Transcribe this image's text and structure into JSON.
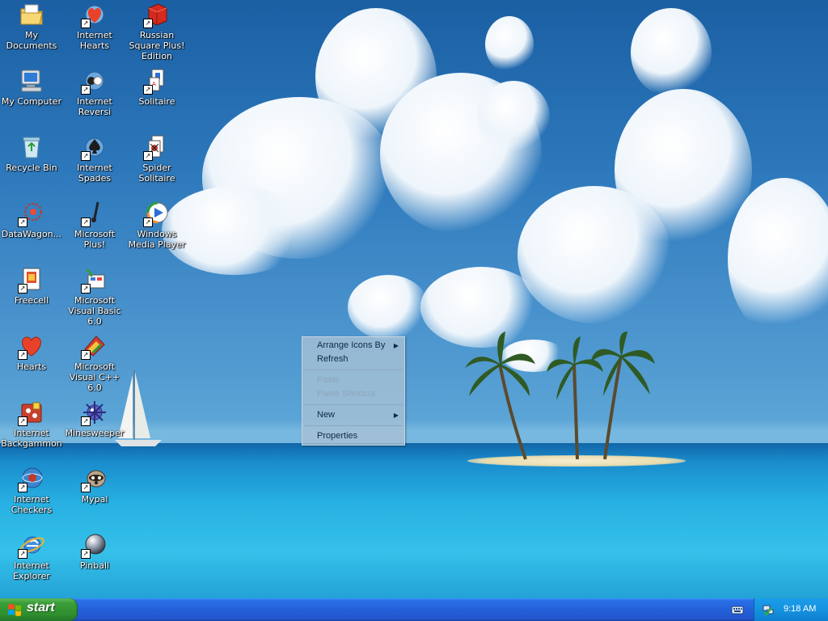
{
  "desktop": {
    "icons": [
      {
        "label": "My Documents"
      },
      {
        "label": "Internet Hearts"
      },
      {
        "label": "Russian Square Plus! Edition"
      },
      {
        "label": "My Computer"
      },
      {
        "label": "Internet Reversi"
      },
      {
        "label": "Solitaire"
      },
      {
        "label": "Recycle Bin"
      },
      {
        "label": "Internet Spades"
      },
      {
        "label": "Spider Solitaire"
      },
      {
        "label": "DataWagon..."
      },
      {
        "label": "Microsoft Plus!"
      },
      {
        "label": "Windows Media Player"
      },
      {
        "label": "Freecell"
      },
      {
        "label": "Microsoft Visual Basic 6.0"
      },
      {
        "label": "Hearts"
      },
      {
        "label": "Microsoft Visual C++ 6.0"
      },
      {
        "label": "Internet Backgammon"
      },
      {
        "label": "Minesweeper"
      },
      {
        "label": "Internet Checkers"
      },
      {
        "label": "Mypal"
      },
      {
        "label": "Internet Explorer"
      },
      {
        "label": "Pinball"
      }
    ]
  },
  "context_menu": {
    "items": [
      {
        "label": "Arrange Icons By",
        "submenu": true,
        "enabled": true
      },
      {
        "label": "Refresh",
        "enabled": true
      },
      {
        "label": "Paste",
        "enabled": false
      },
      {
        "label": "Paste Shortcut",
        "enabled": false
      },
      {
        "label": "New",
        "submenu": true,
        "enabled": true
      },
      {
        "label": "Properties",
        "enabled": true
      }
    ]
  },
  "taskbar": {
    "start_label": "start",
    "clock": "9:18 AM"
  },
  "colors": {
    "taskbar_blue": "#2461d9",
    "start_green": "#3c9e3a",
    "tray_blue": "#1592df"
  }
}
